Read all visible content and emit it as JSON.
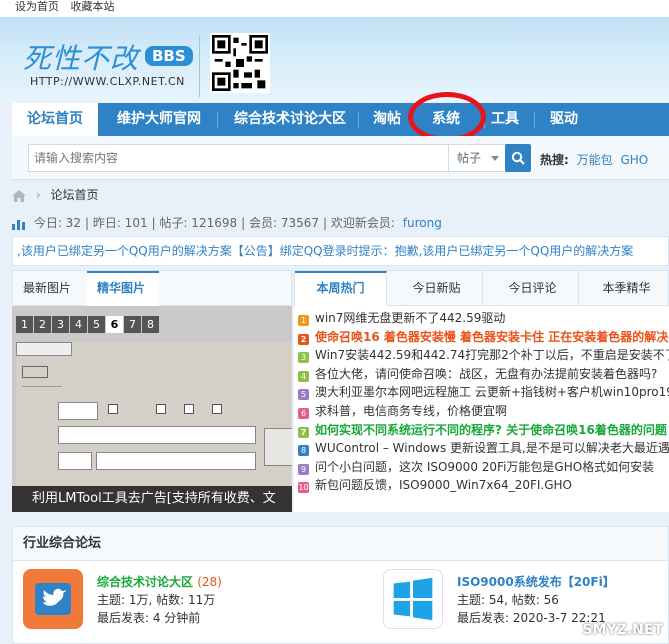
{
  "topbar": {
    "set_home": "设为首页",
    "bookmark": "收藏本站"
  },
  "logo": {
    "title": "死性不改",
    "badge": "BBS",
    "url": "HTTP://WWW.CLXP.NET.CN"
  },
  "nav": {
    "items": [
      "论坛首页",
      "维护大师官网",
      "综合技术讨论大区",
      "淘帖",
      "系统",
      "工具",
      "驱动"
    ]
  },
  "search": {
    "placeholder": "请输入搜索内容",
    "scope": "帖子",
    "hot_label": "热搜:",
    "hot_terms": [
      "万能包",
      "GHO"
    ]
  },
  "breadcrumb": {
    "home": "论坛首页"
  },
  "stats": {
    "today": "今日: 32",
    "yesterday": "昨日: 101",
    "posts": "帖子: 121698",
    "members": "会员: 73567",
    "welcome": "欢迎新会员:",
    "new_user": "furong"
  },
  "announcement": ",该用户已绑定另一个QQ用户的解决方案【公告】绑定QQ登录时提示：抱歉,该用户已绑定另一个QQ用户的解决方案",
  "slider": {
    "tabs": [
      "最新图片",
      "精华图片"
    ],
    "numbers": [
      "1",
      "2",
      "3",
      "4",
      "5",
      "6",
      "7",
      "8"
    ],
    "caption": "利用LMTool工具去广告[支持所有收费、文"
  },
  "hot": {
    "tabs": [
      "本周热门",
      "今日新贴",
      "今日评论",
      "本季精华"
    ],
    "items": [
      "win7网维无盘更新不了442.59驱动",
      "使命召唤16 着色器安装慢 着色器安装卡住 正在安装着色器的解决",
      "Win7安装442.59和442.74打完那2个补丁以后，不重启是安装不了",
      "各位大佬，请问使命召唤：战区，无盘有办法提前安装着色器吗?",
      "澳大利亚墨尔本网吧远程施工 云更新+指钱树+客户机win10pro19",
      "求科普，电信商务专线，价格便宜啊",
      "如何实现不同系统运行不同的程序? 关于使命召唤16着色器的问题",
      "WUControl – Windows 更新设置工具,是不是可以解决老大最近遇",
      "问个小白问题，这次 ISO9000 20Fi万能包是GHO格式如何安装",
      "新包问题反馈，ISO9000_Win7x64_20FI.GHO"
    ]
  },
  "section": {
    "title": "行业综合论坛",
    "forums": [
      {
        "name": "综合技术讨论大区",
        "count": "(28)",
        "topics": "主题: 1万, 帖数: 11万",
        "last": "最后发表: 4 分钟前"
      },
      {
        "name": "ISO9000系统发布【20Fi】",
        "count": "",
        "topics": "主题: 54, 帖数: 56",
        "last": "最后发表: 2020-3-7 22:21"
      }
    ]
  },
  "watermark": "SMYZ.NET"
}
